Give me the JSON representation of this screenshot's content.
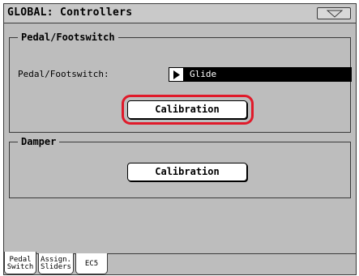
{
  "window": {
    "title": "GLOBAL: Controllers"
  },
  "pedal_group": {
    "title": "Pedal/Footswitch",
    "field_label": "Pedal/Footswitch:",
    "field_value": "Glide",
    "calibration_label": "Calibration"
  },
  "damper_group": {
    "title": "Damper",
    "calibration_label": "Calibration"
  },
  "tabs": [
    {
      "line1": "Pedal",
      "line2": "Switch",
      "active": true
    },
    {
      "line1": "Assign.",
      "line2": "Sliders",
      "active": false
    },
    {
      "line1": "EC5",
      "line2": "",
      "active": false
    }
  ],
  "colors": {
    "panel_background": "#bdbdbd",
    "highlight": "#e01a2a",
    "value_box": "#000000"
  },
  "icons": {
    "menu": "triangle-down-icon",
    "field_arrow": "play-arrow-icon"
  }
}
